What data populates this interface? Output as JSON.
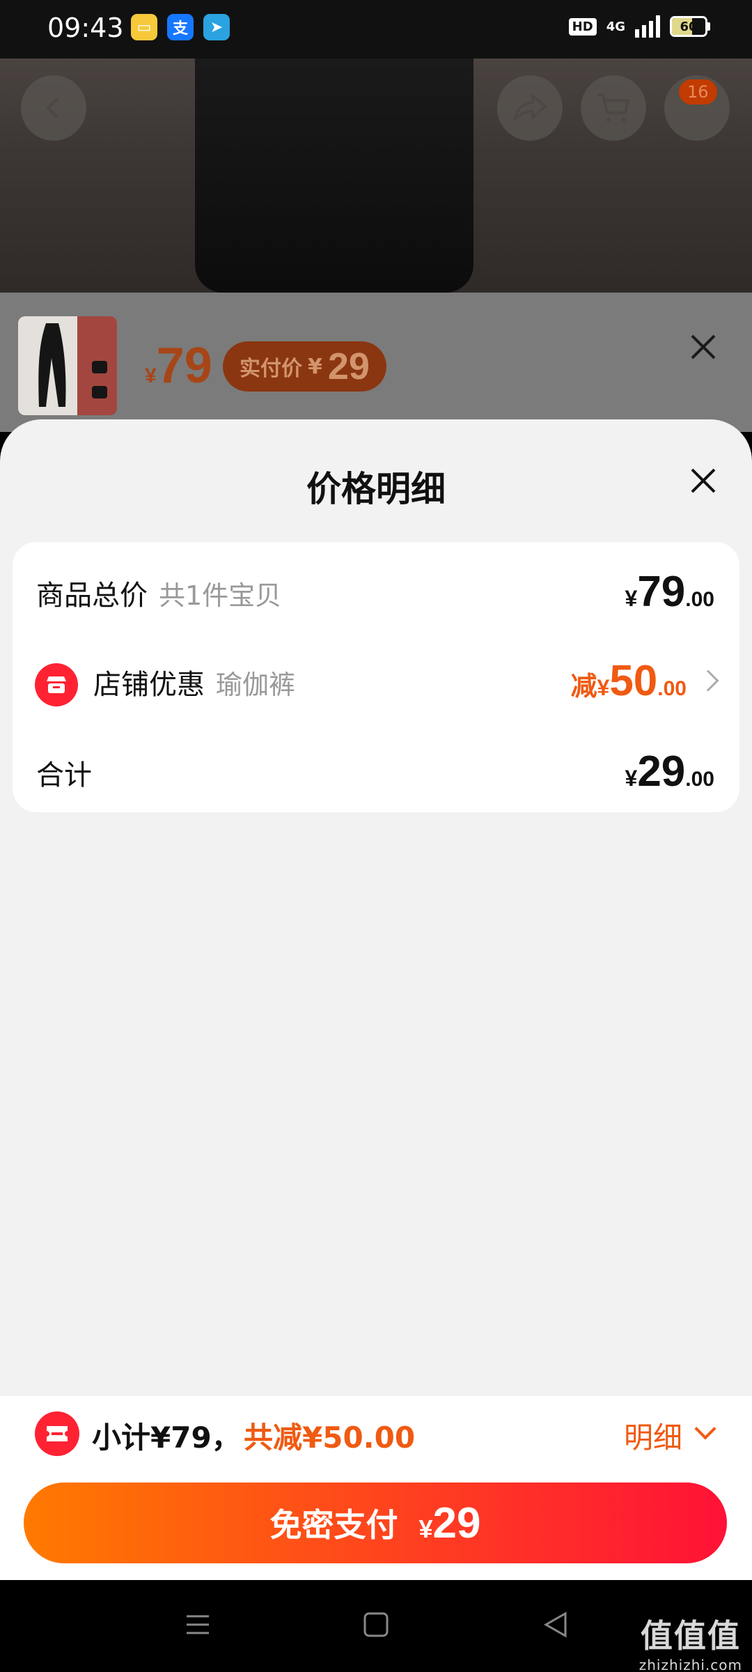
{
  "status_bar": {
    "time": "09:43",
    "network": "4G",
    "battery": "60",
    "battery_level": 0.6,
    "hd": "HD",
    "apps": [
      "notes-app-icon",
      "alipay-app-icon",
      "telegram-app-icon"
    ]
  },
  "top_nav": {
    "cart_badge": "16",
    "icons": [
      "back-arrow-icon",
      "share-icon",
      "cart-icon"
    ]
  },
  "sku": {
    "yen": "¥",
    "price": "79",
    "pill_label": "实付价",
    "pill_yen": "¥",
    "pill_price": "29"
  },
  "sheet": {
    "title": "价格明细",
    "rows": [
      {
        "label": "商品总价",
        "sub": "共1件宝贝",
        "yen": "¥",
        "int": "79",
        "dec": ".00"
      },
      {
        "label": "店铺优惠",
        "sub": "瑜伽裤",
        "prefix": "减",
        "yen": "¥",
        "int": "50",
        "dec": ".00"
      },
      {
        "label": "合计",
        "yen": "¥",
        "int": "29",
        "dec": ".00"
      }
    ]
  },
  "bottom": {
    "subtotal": "小计¥79，",
    "reduce": "共减¥50.00",
    "detail": "明细",
    "pay_label": "免密支付",
    "pay_yen": "¥",
    "pay_amount": "29"
  },
  "watermark": {
    "line1": "值值值",
    "line2": "zhizhizhi.com"
  },
  "colors": {
    "accent": "#f05a12",
    "brand_red": "#ff2233",
    "gradient_start": "#ff7a00",
    "gradient_end": "#ff1237"
  }
}
